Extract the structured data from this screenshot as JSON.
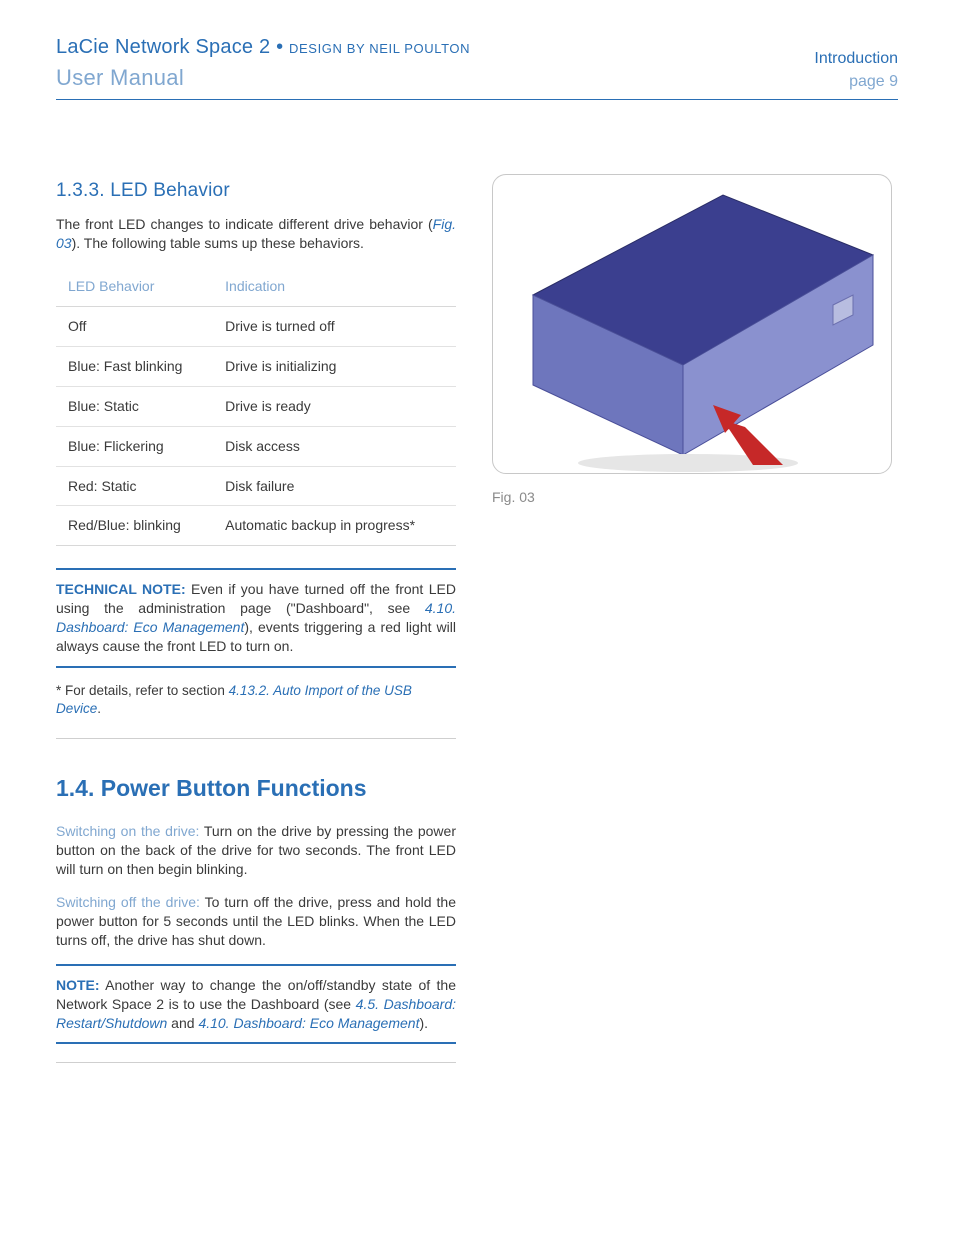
{
  "header": {
    "title_main": "LaCie Network Space 2",
    "title_bullet": "•",
    "title_sub": "DESIGN BY NEIL POULTON",
    "subtitle": "User Manual",
    "right1": "Introduction",
    "right2": "page 9"
  },
  "sec133": {
    "heading": "1.3.3.   LED Behavior",
    "intro_a": "The front LED changes to indicate different drive behavior (",
    "intro_link": "Fig. 03",
    "intro_b": "). The following table sums up these behaviors."
  },
  "table": {
    "h1": "LED Behavior",
    "h2": "Indication",
    "rows": [
      {
        "c1": "Off",
        "c2": "Drive is turned off"
      },
      {
        "c1": "Blue: Fast blinking",
        "c2": "Drive is initializing"
      },
      {
        "c1": "Blue: Static",
        "c2": "Drive is ready"
      },
      {
        "c1": "Blue: Flickering",
        "c2": "Disk access"
      },
      {
        "c1": "Red: Static",
        "c2": "Disk failure"
      },
      {
        "c1": "Red/Blue: blinking",
        "c2": "Automatic backup in prog­ress*"
      }
    ]
  },
  "technote": {
    "label": "TECHNICAL NOTE:",
    "a": " Even if you have turned off the front LED us­ing the administration page (\"Dashboard\", see ",
    "link": "4.10. Dashboard: Eco Management",
    "b": "), events triggering a red light will always cause the front LED to turn on."
  },
  "footnote": {
    "bullet": "* For details, refer to section ",
    "link": "4.13.2. Auto Import of the USB Device",
    "tail": "."
  },
  "sec14": {
    "heading": "1.4.  Power Button Functions",
    "p1_lead": "Switching on the drive: ",
    "p1_body": "Turn on the drive by pressing the power but­ton on the back of the drive for two seconds. The front LED will turn on then begin blinking.",
    "p2_lead": "Switching off the drive: ",
    "p2_body": "To turn off the drive, press and hold the power button for 5 seconds until the LED blinks. When the LED turns off, the drive has shut down."
  },
  "note2": {
    "label": "NOTE:",
    "a": " Another way to change the on/off/standby state of the Net­work Space 2 is to use the Dashboard (see ",
    "link1": "4.5. Dashboard: Restart/Shutdown",
    "mid": " and ",
    "link2": "4.10. Dashboard: Eco Management",
    "b": ")."
  },
  "figure": {
    "caption": "Fig. 03"
  }
}
